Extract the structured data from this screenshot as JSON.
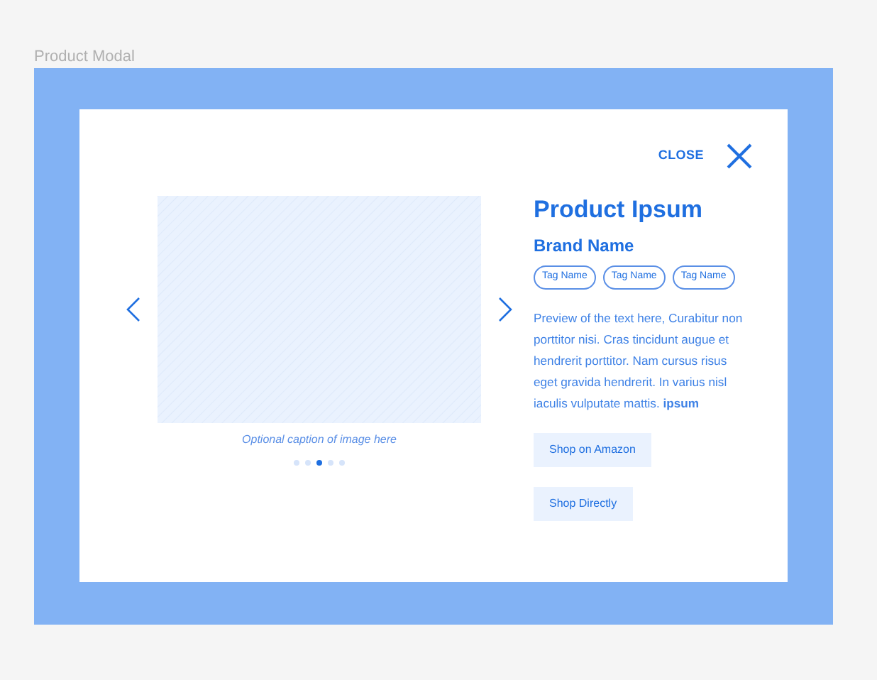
{
  "frame_label": "Product Modal",
  "modal": {
    "close_label": "CLOSE",
    "gallery": {
      "caption": "Optional caption of image here",
      "dots": [
        {
          "selected": false
        },
        {
          "selected": false
        },
        {
          "selected": true
        },
        {
          "selected": false
        },
        {
          "selected": false
        }
      ]
    },
    "product": {
      "title": "Product Ipsum",
      "brand": "Brand Name",
      "tags": [
        "Tag Name",
        "Tag Name",
        "Tag Name"
      ],
      "description": "Preview of the text here, Curabitur non porttitor nisi. Cras tincidunt augue et hendrerit porttitor. Nam cursus risus eget gravida hendrerit. In varius nisl iaculis vulputate mattis.  **ipsum**",
      "buttons": [
        "Shop on Amazon",
        "Shop Directly"
      ]
    }
  }
}
